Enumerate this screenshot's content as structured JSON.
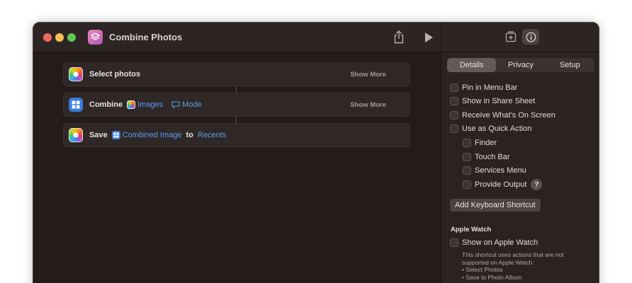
{
  "window": {
    "title": "Combine Photos",
    "app_icon": "shortcuts-icon"
  },
  "actions": [
    {
      "icon": "photos-icon",
      "verb": "Select photos",
      "show_more": "Show More"
    },
    {
      "icon": "combine-icon",
      "verb": "Combine",
      "param1": "Images",
      "param2": "Mode",
      "show_more": "Show More"
    },
    {
      "icon": "photos-icon",
      "verb": "Save",
      "param1": "Combined Image",
      "joiner": "to",
      "param2": "Recents"
    }
  ],
  "sidebar": {
    "tabs": [
      "Details",
      "Privacy",
      "Setup"
    ],
    "active_tab": "Details",
    "options": [
      "Pin in Menu Bar",
      "Show in Share Sheet",
      "Receive What’s On Screen",
      "Use as Quick Action"
    ],
    "quick_action_options": [
      "Finder",
      "Touch Bar",
      "Services Menu",
      "Provide Output"
    ],
    "help_label": "?",
    "keyboard_button": "Add Keyboard Shortcut",
    "apple_watch_section": "Apple Watch",
    "apple_watch_option": "Show on Apple Watch",
    "note_lines": [
      "This shortcut uses actions that are not",
      "supported on Apple Watch:",
      "• Select Photos",
      "• Save to Photo Album"
    ]
  },
  "colors": {
    "accent_token": "#5d9cf0",
    "window_bg": "#231c1a",
    "close": "#ed6a5e",
    "minimize": "#f5bf4f",
    "maximize": "#61c554"
  }
}
